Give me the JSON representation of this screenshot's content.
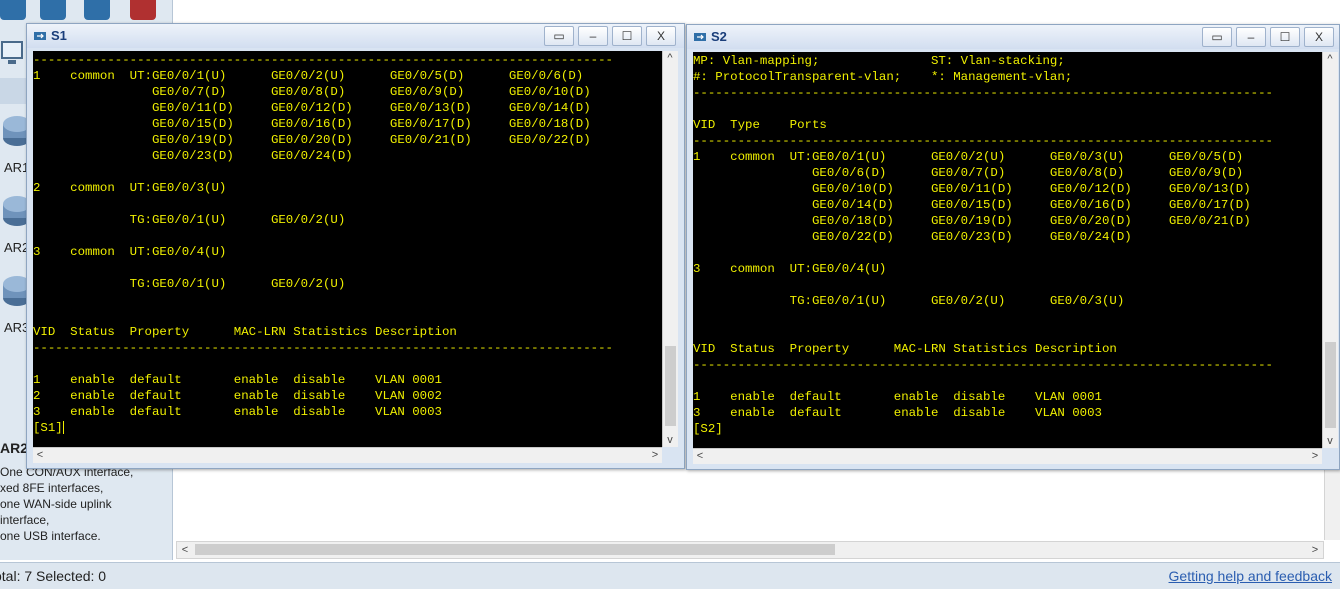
{
  "left_panel": {
    "routers": [
      {
        "label": "AR1"
      },
      {
        "label": "AR2"
      },
      {
        "label": "AR3"
      }
    ],
    "description_title": "AR2",
    "description_lines": [
      "One CON/AUX interface,",
      "xed 8FE interfaces,",
      "one WAN-side uplink",
      "interface,",
      "one USB interface."
    ]
  },
  "statusbar": {
    "status": "otal: 7  Selected: 0",
    "help_link": "Getting help and feedback"
  },
  "colors": {
    "terminal_bg": "#000000",
    "terminal_text": "#f0f000",
    "window_title": "#1a3e7a"
  },
  "s1": {
    "title": "S1",
    "buttons": {
      "restore": "▭",
      "minimize": "–",
      "maximize": "☐",
      "close": "X"
    },
    "lines": [
      "------------------------------------------------------------------------------",
      "1    common  UT:GE0/0/1(U)      GE0/0/2(U)      GE0/0/5(D)      GE0/0/6(D)",
      "                GE0/0/7(D)      GE0/0/8(D)      GE0/0/9(D)      GE0/0/10(D)",
      "                GE0/0/11(D)     GE0/0/12(D)     GE0/0/13(D)     GE0/0/14(D)",
      "                GE0/0/15(D)     GE0/0/16(D)     GE0/0/17(D)     GE0/0/18(D)",
      "                GE0/0/19(D)     GE0/0/20(D)     GE0/0/21(D)     GE0/0/22(D)",
      "                GE0/0/23(D)     GE0/0/24(D)",
      "",
      "2    common  UT:GE0/0/3(U)",
      "",
      "             TG:GE0/0/1(U)      GE0/0/2(U)",
      "",
      "3    common  UT:GE0/0/4(U)",
      "",
      "             TG:GE0/0/1(U)      GE0/0/2(U)",
      "",
      "",
      "VID  Status  Property      MAC-LRN Statistics Description",
      "------------------------------------------------------------------------------",
      "",
      "1    enable  default       enable  disable    VLAN 0001",
      "2    enable  default       enable  disable    VLAN 0002",
      "3    enable  default       enable  disable    VLAN 0003"
    ],
    "prompt": "[S1]"
  },
  "s2": {
    "title": "S2",
    "buttons": {
      "restore": "▭",
      "minimize": "–",
      "maximize": "☐",
      "close": "X"
    },
    "lines": [
      "MP: Vlan-mapping;               ST: Vlan-stacking;",
      "#: ProtocolTransparent-vlan;    *: Management-vlan;",
      "------------------------------------------------------------------------------",
      "",
      "VID  Type    Ports",
      "------------------------------------------------------------------------------",
      "1    common  UT:GE0/0/1(U)      GE0/0/2(U)      GE0/0/3(U)      GE0/0/5(D)",
      "                GE0/0/6(D)      GE0/0/7(D)      GE0/0/8(D)      GE0/0/9(D)",
      "                GE0/0/10(D)     GE0/0/11(D)     GE0/0/12(D)     GE0/0/13(D)",
      "                GE0/0/14(D)     GE0/0/15(D)     GE0/0/16(D)     GE0/0/17(D)",
      "                GE0/0/18(D)     GE0/0/19(D)     GE0/0/20(D)     GE0/0/21(D)",
      "                GE0/0/22(D)     GE0/0/23(D)     GE0/0/24(D)",
      "",
      "3    common  UT:GE0/0/4(U)",
      "",
      "             TG:GE0/0/1(U)      GE0/0/2(U)      GE0/0/3(U)",
      "",
      "",
      "VID  Status  Property      MAC-LRN Statistics Description",
      "------------------------------------------------------------------------------",
      "",
      "1    enable  default       enable  disable    VLAN 0001",
      "3    enable  default       enable  disable    VLAN 0003"
    ],
    "prompt": "[S2]"
  }
}
